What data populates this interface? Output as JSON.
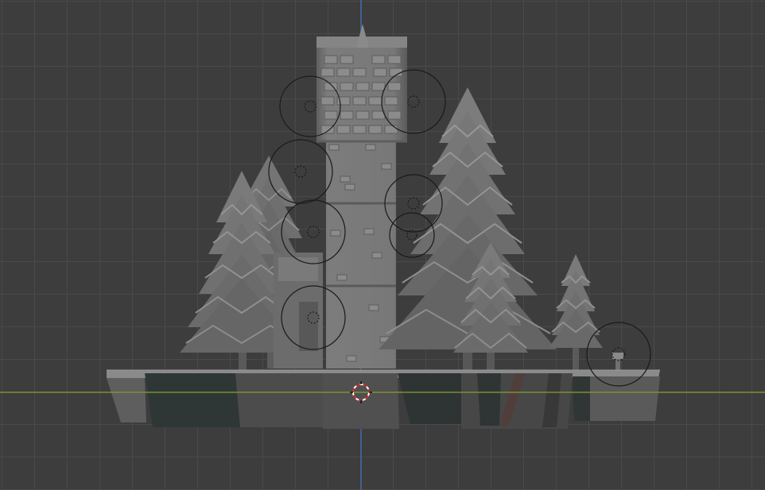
{
  "viewport": {
    "type": "3d-viewport",
    "view": "front-orthographic",
    "grid": true,
    "colors": {
      "background": "#3d3d3d",
      "grid": "#4a4a4a",
      "x_axis": "#7e9a2a",
      "z_axis": "#3f6aa3",
      "mesh_light": "#8a8a8a",
      "mesh_mid": "#6e6e6e",
      "mesh_dark": "#4f4f4f",
      "base_dark": "#2e3433",
      "cursor": "#d12b2b"
    }
  },
  "scene": {
    "objects": [
      {
        "name": "tower",
        "icon": "tower-icon"
      },
      {
        "name": "pine-tree-large",
        "icon": "tree-icon"
      },
      {
        "name": "pine-tree-left",
        "icon": "tree-icon"
      },
      {
        "name": "pine-tree-back-left",
        "icon": "tree-icon"
      },
      {
        "name": "pine-tree-front",
        "icon": "tree-icon"
      },
      {
        "name": "pine-tree-small-right",
        "icon": "tree-icon"
      },
      {
        "name": "ground-base",
        "icon": "mesh-icon"
      },
      {
        "name": "lamp-post",
        "icon": "mesh-icon"
      }
    ],
    "light_gizmos": 8,
    "cursor": "3d-cursor-icon"
  }
}
